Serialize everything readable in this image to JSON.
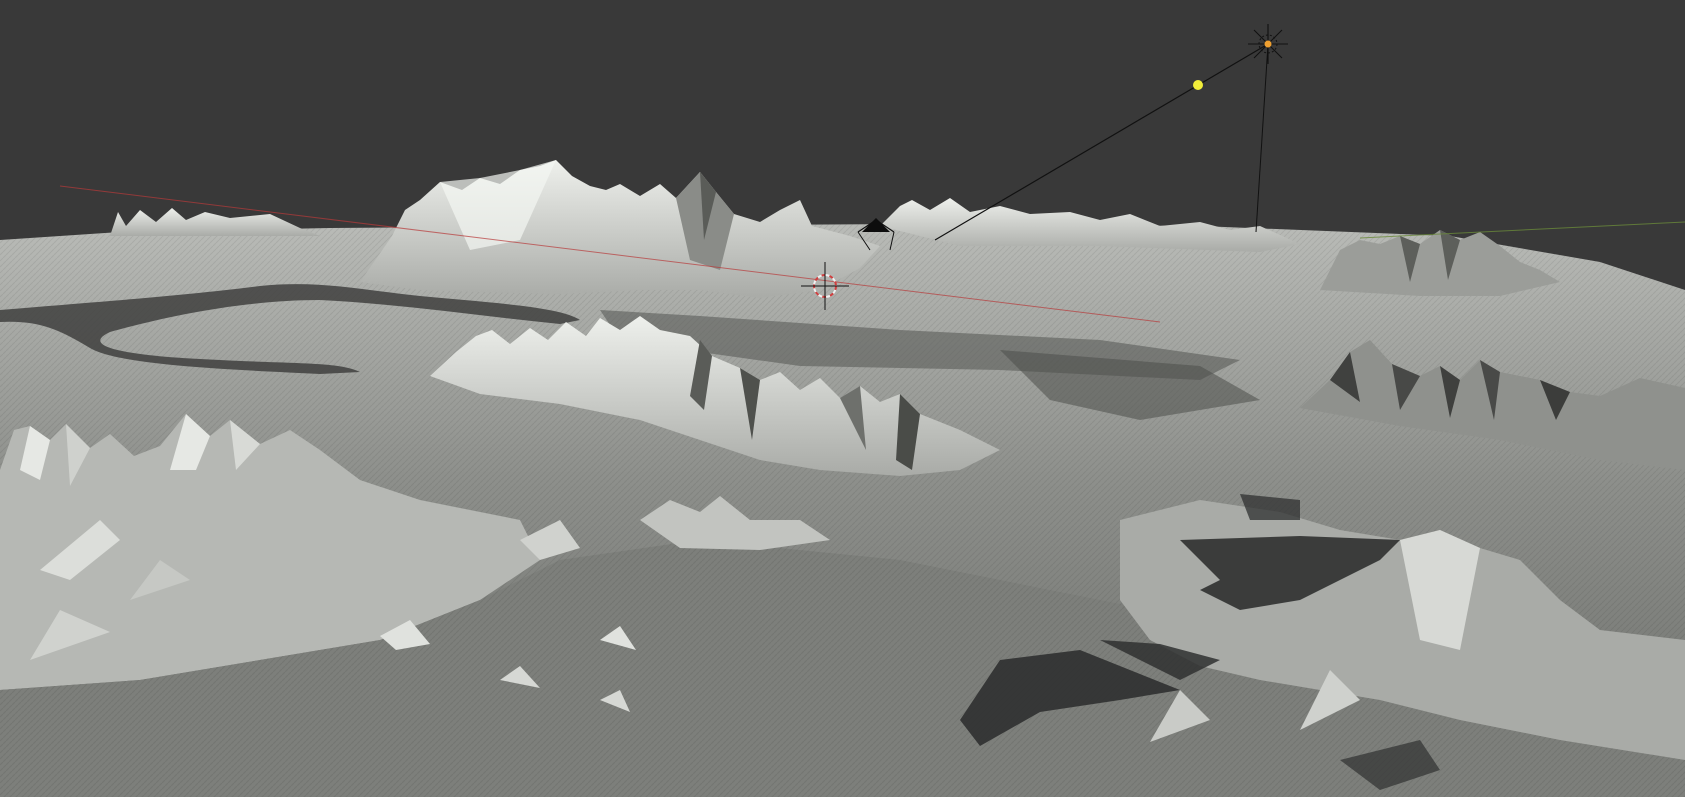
{
  "scene": {
    "view": "3D viewport",
    "content": "terrain-mesh",
    "colors": {
      "background": "#393939",
      "terrain_light": "#d6d8d4",
      "terrain_mid": "#9a9c98",
      "terrain_dark": "#4a4b49",
      "shadow": "#2f3030",
      "light_gizmo": "#f0a030",
      "light_handle": "#f2ee3a",
      "axis_x": "#b83a3a",
      "axis_y": "#6a8a3a",
      "cursor": "#d04040"
    },
    "icons": [
      "sun-light-icon",
      "light-target-handle",
      "camera-object-icon",
      "3d-cursor-icon"
    ]
  }
}
